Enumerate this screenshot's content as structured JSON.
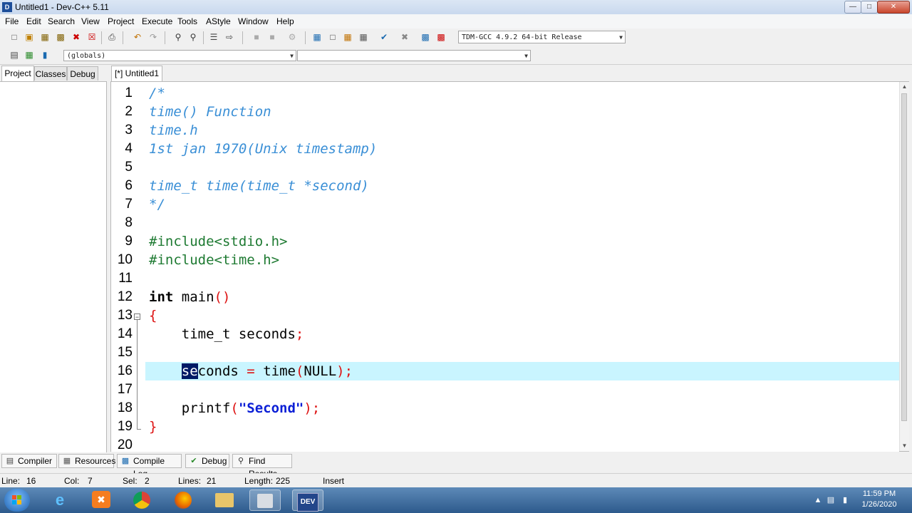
{
  "window": {
    "title": "Untitled1 - Dev-C++ 5.11"
  },
  "menu": [
    "File",
    "Edit",
    "Search",
    "View",
    "Project",
    "Execute",
    "Tools",
    "AStyle",
    "Window",
    "Help"
  ],
  "toolbar": {
    "compiler_select": "TDM-GCC 4.9.2 64-bit Release",
    "scope_select": "(globals)",
    "symbol_select": ""
  },
  "left_panel": {
    "tabs": [
      "Project",
      "Classes",
      "Debug"
    ]
  },
  "editor": {
    "tab_label": "[*] Untitled1",
    "lines": [
      {
        "n": "1"
      },
      {
        "n": "2"
      },
      {
        "n": "3"
      },
      {
        "n": "4"
      },
      {
        "n": "5"
      },
      {
        "n": "6"
      },
      {
        "n": "7"
      },
      {
        "n": "8"
      },
      {
        "n": "9"
      },
      {
        "n": "10"
      },
      {
        "n": "11"
      },
      {
        "n": "12"
      },
      {
        "n": "13"
      },
      {
        "n": "14"
      },
      {
        "n": "15"
      },
      {
        "n": "16"
      },
      {
        "n": "17"
      },
      {
        "n": "18"
      },
      {
        "n": "19"
      },
      {
        "n": "20"
      }
    ],
    "code": {
      "l1": "/*",
      "l2": "time() Function",
      "l3": "time.h",
      "l4": "1st jan 1970(Unix timestamp)",
      "l6": "time_t time(time_t *second)",
      "l7": "*/",
      "l9": "#include<stdio.h>",
      "l10": "#include<time.h>",
      "l12_kw": "int",
      "l12_rest": " main",
      "l12_paren": "()",
      "l13": "{",
      "l14_a": "    time_t seconds",
      "l14_b": ";",
      "l16_indent": "    ",
      "l16_sel": "se",
      "l16_a": "conds ",
      "l16_eq": "=",
      "l16_b": " time",
      "l16_p1": "(",
      "l16_null": "NULL",
      "l16_p2": ");",
      "l18_a": "    printf",
      "l18_p1": "(",
      "l18_str": "\"Second\"",
      "l18_p2": ");",
      "l19": "}"
    }
  },
  "bottom_tabs": [
    "Compiler",
    "Resources",
    "Compile Log",
    "Debug",
    "Find Results"
  ],
  "status": {
    "line_label": "Line:",
    "line": "16",
    "col_label": "Col:",
    "col": "7",
    "sel_label": "Sel:",
    "sel": "2",
    "lines_label": "Lines:",
    "lines": "21",
    "length_label": "Length:",
    "length": "225",
    "mode": "Insert"
  },
  "taskbar": {
    "time": "11:59 PM",
    "date": "1/26/2020"
  }
}
